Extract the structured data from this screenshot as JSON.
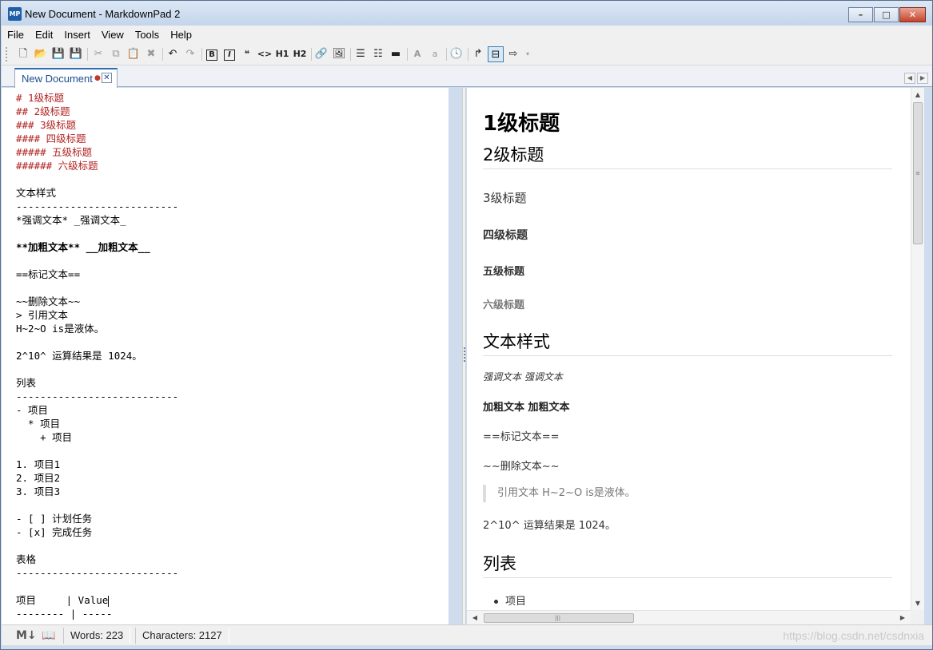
{
  "window": {
    "title": "New Document - MarkdownPad 2",
    "app_icon_text": "MP",
    "minimize_glyph": "–",
    "maximize_glyph": "□",
    "close_glyph": "✕"
  },
  "menu": [
    "File",
    "Edit",
    "Insert",
    "View",
    "Tools",
    "Help"
  ],
  "toolbar": {
    "bold_label": "B",
    "italic_label": "I",
    "h1_label": "H1",
    "h2_label": "H2",
    "font_large_label": "A",
    "font_small_label": "a"
  },
  "tab": {
    "label": "New Document",
    "modified_marker": "●",
    "close_glyph": "✕"
  },
  "editor": {
    "lines": [
      {
        "text": "# 1级标题",
        "style": "h"
      },
      {
        "text": "## 2级标题",
        "style": "h"
      },
      {
        "text": "### 3级标题",
        "style": "h"
      },
      {
        "text": "#### 四级标题",
        "style": "h"
      },
      {
        "text": "##### 五级标题",
        "style": "h"
      },
      {
        "text": "###### 六级标题",
        "style": "h"
      },
      {
        "text": "",
        "style": ""
      },
      {
        "text": "文本样式",
        "style": ""
      },
      {
        "text": "---------------------------",
        "style": ""
      },
      {
        "text": "*强调文本* _强调文本_",
        "style": ""
      },
      {
        "text": "",
        "style": ""
      },
      {
        "text": "**加粗文本** __加粗文本__",
        "style": "b"
      },
      {
        "text": "",
        "style": ""
      },
      {
        "text": "==标记文本==",
        "style": ""
      },
      {
        "text": "",
        "style": ""
      },
      {
        "text": "~~删除文本~~",
        "style": ""
      },
      {
        "text": "> 引用文本",
        "style": ""
      },
      {
        "text": "H~2~O is是液体。",
        "style": ""
      },
      {
        "text": "",
        "style": ""
      },
      {
        "text": "2^10^ 运算结果是 1024。",
        "style": ""
      },
      {
        "text": "",
        "style": ""
      },
      {
        "text": "列表",
        "style": ""
      },
      {
        "text": "---------------------------",
        "style": ""
      },
      {
        "text": "- 项目",
        "style": ""
      },
      {
        "text": "  * 项目",
        "style": ""
      },
      {
        "text": "    + 项目",
        "style": ""
      },
      {
        "text": "",
        "style": ""
      },
      {
        "text": "1. 项目1",
        "style": ""
      },
      {
        "text": "2. 项目2",
        "style": ""
      },
      {
        "text": "3. 项目3",
        "style": ""
      },
      {
        "text": "",
        "style": ""
      },
      {
        "text": "- [ ] 计划任务",
        "style": ""
      },
      {
        "text": "- [x] 完成任务",
        "style": ""
      },
      {
        "text": "",
        "style": ""
      },
      {
        "text": "表格",
        "style": ""
      },
      {
        "text": "---------------------------",
        "style": ""
      },
      {
        "text": "",
        "style": ""
      },
      {
        "text": "项目     | Value",
        "style": "caret"
      },
      {
        "text": "-------- | -----",
        "style": ""
      }
    ]
  },
  "preview": {
    "h1": "1级标题",
    "h2": "2级标题",
    "h3": "3级标题",
    "h4": "四级标题",
    "h5": "五级标题",
    "h6": "六级标题",
    "section_text_style": "文本样式",
    "emphasis": "强调文本 强调文本",
    "strong": "加粗文本 加粗文本",
    "mark": "==标记文本==",
    "strike": "~~删除文本~~",
    "blockquote": "引用文本 H~2~O is是液体。",
    "superscript": "2^10^ 运算结果是 1024。",
    "section_list": "列表",
    "list_item": "项目"
  },
  "status": {
    "words": "Words: 223",
    "characters": "Characters: 2127",
    "watermark": "https://blog.csdn.net/csdnxia"
  }
}
